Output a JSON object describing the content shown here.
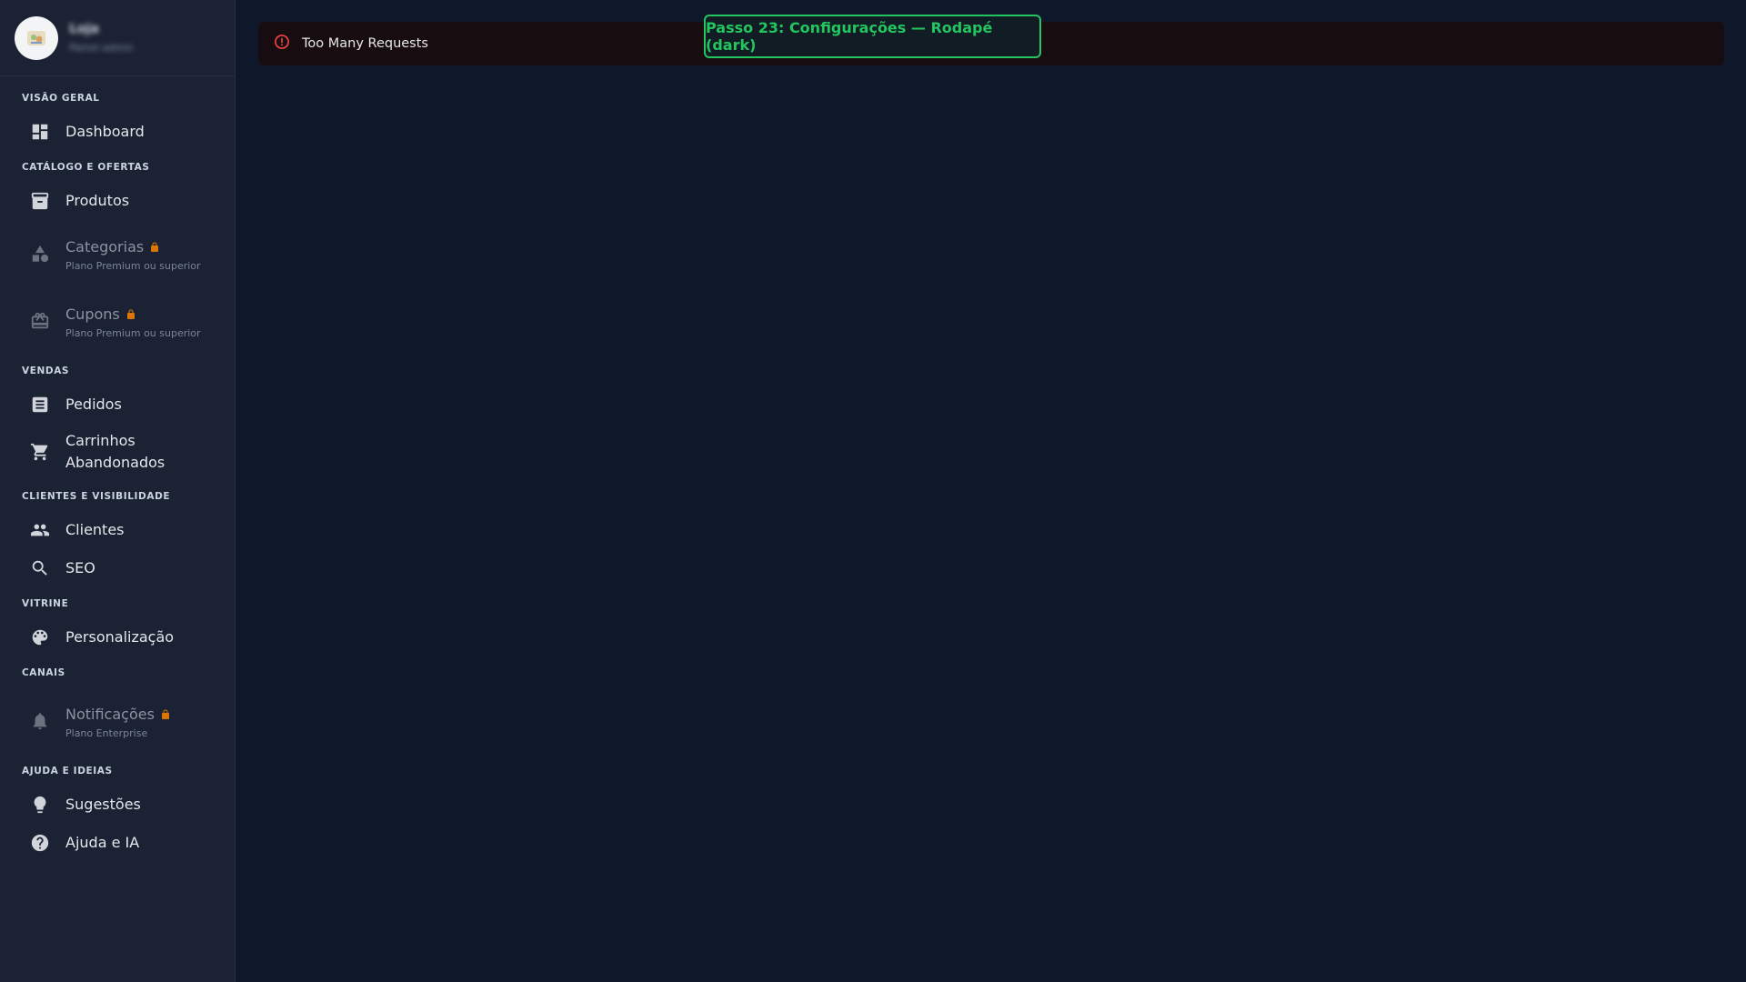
{
  "sidebar": {
    "store_name": "Loja",
    "store_sub": "Painel admin",
    "sections": [
      {
        "title": "VISÃO GERAL"
      },
      {
        "title": "CATÁLOGO E OFERTAS"
      },
      {
        "title": "VENDAS"
      },
      {
        "title": "CLIENTES E VISIBILIDADE"
      },
      {
        "title": "VITRINE"
      },
      {
        "title": "CANAIS"
      },
      {
        "title": "AJUDA E IDEIAS"
      }
    ],
    "items": {
      "dashboard": {
        "label": "Dashboard",
        "icon": "dashboard-icon"
      },
      "produtos": {
        "label": "Produtos",
        "icon": "archive-icon"
      },
      "categorias": {
        "label": "Categorias",
        "sub": "Plano Premium ou superior",
        "icon": "category-icon",
        "locked": true
      },
      "cupons": {
        "label": "Cupons",
        "sub": "Plano Premium ou superior",
        "icon": "gift-card-icon",
        "locked": true
      },
      "pedidos": {
        "label": "Pedidos",
        "icon": "receipt-icon"
      },
      "carrinhos": {
        "label": "Carrinhos Abandonados",
        "icon": "cart-icon"
      },
      "clientes": {
        "label": "Clientes",
        "icon": "people-icon"
      },
      "seo": {
        "label": "SEO",
        "icon": "search-icon"
      },
      "personalizacao": {
        "label": "Personalização",
        "icon": "palette-icon"
      },
      "notificacoes": {
        "label": "Notificações",
        "sub": "Plano Enterprise",
        "icon": "bell-icon",
        "locked": true
      },
      "sugestoes": {
        "label": "Sugestões",
        "icon": "lightbulb-icon"
      },
      "ajuda": {
        "label": "Ajuda e IA",
        "icon": "help-icon"
      }
    }
  },
  "main": {
    "error_text": "Too Many Requests",
    "step_badge": "Passo 23: Configurações — Rodapé (dark)"
  },
  "colors": {
    "background": "#0f172a",
    "sidebar": "#1a2233",
    "error_bg": "#170c10",
    "error_icon": "#ef4444",
    "step_accent": "#22c55e",
    "lock": "#d97706"
  }
}
